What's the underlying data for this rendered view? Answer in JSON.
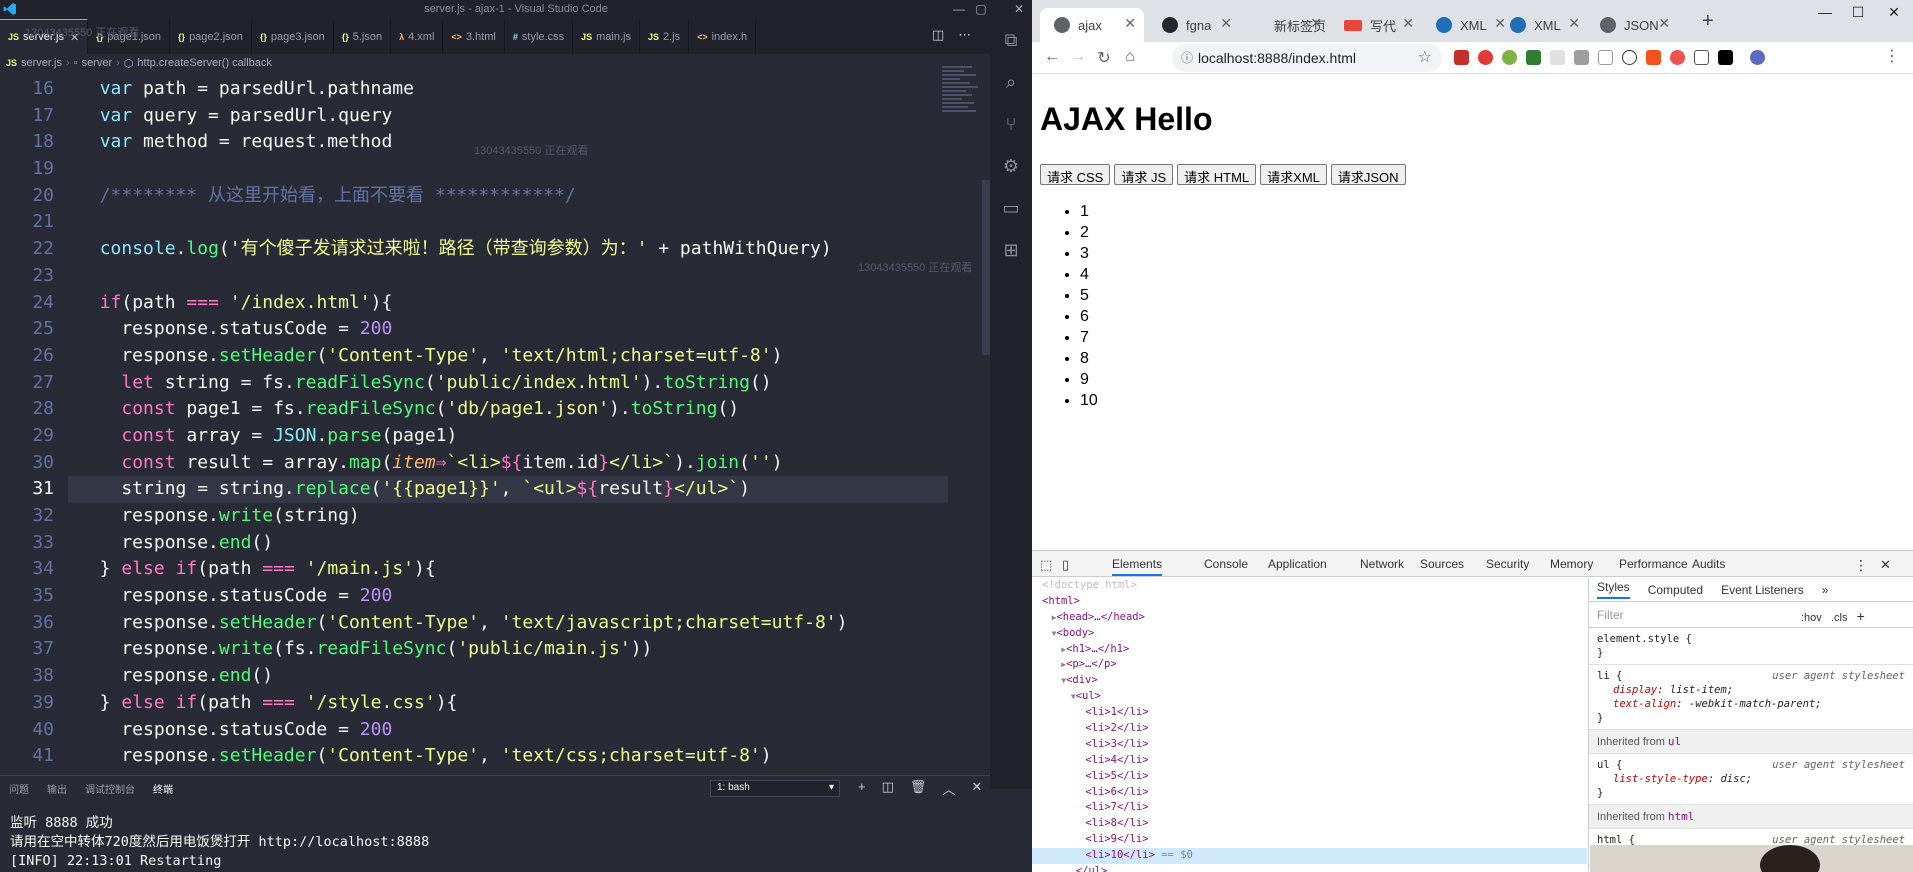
{
  "vscode": {
    "window_title": "server.js - ajax-1 - Visual Studio Code",
    "tabs": [
      {
        "label": "server.js",
        "icon": "JS",
        "icon_color": "#f1fa8c",
        "active": true
      },
      {
        "label": "page1.json",
        "icon": "{}",
        "icon_color": "#f1fa8c"
      },
      {
        "label": "page2.json",
        "icon": "{}",
        "icon_color": "#f1fa8c"
      },
      {
        "label": "page3.json",
        "icon": "{}",
        "icon_color": "#f1fa8c"
      },
      {
        "label": "5.json",
        "icon": "{}",
        "icon_color": "#f1fa8c"
      },
      {
        "label": "4.xml",
        "icon": "λ",
        "icon_color": "#ffb86c"
      },
      {
        "label": "3.html",
        "icon": "<>",
        "icon_color": "#ffb86c"
      },
      {
        "label": "style.css",
        "icon": "#",
        "icon_color": "#8be9fd"
      },
      {
        "label": "main.js",
        "icon": "JS",
        "icon_color": "#f1fa8c"
      },
      {
        "label": "2.js",
        "icon": "JS",
        "icon_color": "#f1fa8c"
      },
      {
        "label": "index.h",
        "icon": "<>",
        "icon_color": "#ffb86c"
      }
    ],
    "breadcrumb": [
      "server.js",
      "server",
      "http.createServer() callback"
    ],
    "watermark_text": "13043435550 正在观看",
    "line_numbers": [
      "16",
      "17",
      "18",
      "19",
      "20",
      "21",
      "22",
      "23",
      "24",
      "25",
      "26",
      "27",
      "28",
      "29",
      "30",
      "31",
      "32",
      "33",
      "34",
      "35",
      "36",
      "37",
      "38",
      "39",
      "40",
      "41"
    ],
    "current_line": "31",
    "code_lines": [
      [
        [
          "  ",
          "pl"
        ],
        [
          "var",
          "cls"
        ],
        [
          " path = parsedUrl.",
          "pl"
        ],
        [
          "pathname",
          "pl"
        ]
      ],
      [
        [
          "  ",
          "pl"
        ],
        [
          "var",
          "cls"
        ],
        [
          " query = parsedUrl.",
          "pl"
        ],
        [
          "query",
          "pl"
        ]
      ],
      [
        [
          "  ",
          "pl"
        ],
        [
          "var",
          "cls"
        ],
        [
          " method = ",
          "pl"
        ],
        [
          "request",
          "pl"
        ],
        [
          ".method",
          "pl"
        ]
      ],
      [
        [
          "",
          "pl"
        ]
      ],
      [
        [
          "  /******** 从这里开始看，上面不要看 ************/",
          "cm"
        ]
      ],
      [
        [
          "",
          "pl"
        ]
      ],
      [
        [
          "  ",
          "pl"
        ],
        [
          "console",
          "cls"
        ],
        [
          ".",
          "pl"
        ],
        [
          "log",
          "fn"
        ],
        [
          "(",
          "pl"
        ],
        [
          "'有个傻子发请求过来啦！路径（带查询参数）为：'",
          "str"
        ],
        [
          " + pathWithQuery)",
          "pl"
        ]
      ],
      [
        [
          "",
          "pl"
        ]
      ],
      [
        [
          "  ",
          "pl"
        ],
        [
          "if",
          "kw"
        ],
        [
          "(path ",
          "pl"
        ],
        [
          "===",
          "kw"
        ],
        [
          " ",
          "pl"
        ],
        [
          "'/index.html'",
          "str"
        ],
        [
          "){",
          "pl"
        ]
      ],
      [
        [
          "    response.",
          "pl"
        ],
        [
          "statusCode",
          "pl"
        ],
        [
          " = ",
          "pl"
        ],
        [
          "200",
          "num"
        ]
      ],
      [
        [
          "    response.",
          "pl"
        ],
        [
          "setHeader",
          "fn"
        ],
        [
          "(",
          "pl"
        ],
        [
          "'Content-Type'",
          "str"
        ],
        [
          ", ",
          "pl"
        ],
        [
          "'text/html;charset=utf-8'",
          "str"
        ],
        [
          ")",
          "pl"
        ]
      ],
      [
        [
          "    ",
          "pl"
        ],
        [
          "let",
          "kw"
        ],
        [
          " string = ",
          "pl"
        ],
        [
          "fs",
          "pl"
        ],
        [
          ".",
          "pl"
        ],
        [
          "readFileSync",
          "fn"
        ],
        [
          "(",
          "pl"
        ],
        [
          "'public/index.html'",
          "str"
        ],
        [
          ").",
          "pl"
        ],
        [
          "toString",
          "fn"
        ],
        [
          "()",
          "pl"
        ]
      ],
      [
        [
          "    ",
          "pl"
        ],
        [
          "const",
          "kw"
        ],
        [
          " page1 = fs.",
          "pl"
        ],
        [
          "readFileSync",
          "fn"
        ],
        [
          "(",
          "pl"
        ],
        [
          "'db/page1.json'",
          "str"
        ],
        [
          ").",
          "pl"
        ],
        [
          "toString",
          "fn"
        ],
        [
          "()",
          "pl"
        ]
      ],
      [
        [
          "    ",
          "pl"
        ],
        [
          "const",
          "kw"
        ],
        [
          " array = ",
          "pl"
        ],
        [
          "JSON",
          "cls"
        ],
        [
          ".",
          "pl"
        ],
        [
          "parse",
          "fn"
        ],
        [
          "(page1)",
          "pl"
        ]
      ],
      [
        [
          "    ",
          "pl"
        ],
        [
          "const",
          "kw"
        ],
        [
          " result = array.",
          "pl"
        ],
        [
          "map",
          "fn"
        ],
        [
          "(",
          "pl"
        ],
        [
          "item",
          "ita"
        ],
        [
          "⇒",
          "kw"
        ],
        [
          "`<li>",
          "str"
        ],
        [
          "${",
          "kw"
        ],
        [
          "item.id",
          "pl"
        ],
        [
          "}",
          "kw"
        ],
        [
          "</li>`",
          "str"
        ],
        [
          ").",
          "pl"
        ],
        [
          "join",
          "fn"
        ],
        [
          "(",
          "pl"
        ],
        [
          "''",
          "str"
        ],
        [
          ")",
          "pl"
        ]
      ],
      [
        [
          "    string = string.",
          "pl"
        ],
        [
          "replace",
          "fn"
        ],
        [
          "(",
          "pl"
        ],
        [
          "'{{page1}}'",
          "str"
        ],
        [
          ", ",
          "pl"
        ],
        [
          "`<ul>",
          "str"
        ],
        [
          "${",
          "kw"
        ],
        [
          "result",
          "pl"
        ],
        [
          "}",
          "kw"
        ],
        [
          "</ul>`",
          "str"
        ],
        [
          ")",
          "pl"
        ]
      ],
      [
        [
          "    response.",
          "pl"
        ],
        [
          "write",
          "fn"
        ],
        [
          "(string)",
          "pl"
        ]
      ],
      [
        [
          "    response.",
          "pl"
        ],
        [
          "end",
          "fn"
        ],
        [
          "()",
          "pl"
        ]
      ],
      [
        [
          "  } ",
          "pl"
        ],
        [
          "else",
          "kw"
        ],
        [
          " ",
          "pl"
        ],
        [
          "if",
          "kw"
        ],
        [
          "(path ",
          "pl"
        ],
        [
          "===",
          "kw"
        ],
        [
          " ",
          "pl"
        ],
        [
          "'/main.js'",
          "str"
        ],
        [
          "){",
          "pl"
        ]
      ],
      [
        [
          "    response.",
          "pl"
        ],
        [
          "statusCode",
          "pl"
        ],
        [
          " = ",
          "pl"
        ],
        [
          "200",
          "num"
        ]
      ],
      [
        [
          "    response.",
          "pl"
        ],
        [
          "setHeader",
          "fn"
        ],
        [
          "(",
          "pl"
        ],
        [
          "'Content-Type'",
          "str"
        ],
        [
          ", ",
          "pl"
        ],
        [
          "'text/javascript;charset=utf-8'",
          "str"
        ],
        [
          ")",
          "pl"
        ]
      ],
      [
        [
          "    response.",
          "pl"
        ],
        [
          "write",
          "fn"
        ],
        [
          "(fs.",
          "pl"
        ],
        [
          "readFileSync",
          "fn"
        ],
        [
          "(",
          "pl"
        ],
        [
          "'public/main.js'",
          "str"
        ],
        [
          "))",
          "pl"
        ]
      ],
      [
        [
          "    response.",
          "pl"
        ],
        [
          "end",
          "fn"
        ],
        [
          "()",
          "pl"
        ]
      ],
      [
        [
          "  } ",
          "pl"
        ],
        [
          "else",
          "kw"
        ],
        [
          " ",
          "pl"
        ],
        [
          "if",
          "kw"
        ],
        [
          "(path ",
          "pl"
        ],
        [
          "===",
          "kw"
        ],
        [
          " ",
          "pl"
        ],
        [
          "'/style.css'",
          "str"
        ],
        [
          "){",
          "pl"
        ]
      ],
      [
        [
          "    response.",
          "pl"
        ],
        [
          "statusCode",
          "pl"
        ],
        [
          " = ",
          "pl"
        ],
        [
          "200",
          "num"
        ]
      ],
      [
        [
          "    response.",
          "pl"
        ],
        [
          "setHeader",
          "fn"
        ],
        [
          "(",
          "pl"
        ],
        [
          "'Content-Type'",
          "str"
        ],
        [
          ", ",
          "pl"
        ],
        [
          "'text/css;charset=utf-8'",
          "str"
        ],
        [
          ")",
          "pl"
        ]
      ]
    ],
    "panel_tabs": [
      "问题",
      "输出",
      "调试控制台",
      "终端"
    ],
    "active_panel_tab": "终端",
    "terminal_select": "1: bash",
    "terminal_lines": [
      "监听 8888 成功",
      "请用在空中转体720度然后用电饭煲打开 http://localhost:8888",
      "[INFO] 22:13:01 Restarting"
    ]
  },
  "chrome": {
    "tabs": [
      {
        "label": "ajax",
        "active": true,
        "fav_color": "#5f6368"
      },
      {
        "label": "fgnа",
        "fav_color": "#24292e"
      },
      {
        "label": "新标签页",
        "fav_color": "#dee1e6"
      },
      {
        "label": "写代",
        "fav_color": "#e8453c",
        "prefix": "XML"
      },
      {
        "label": "XML",
        "fav_color": "#1f6fb6"
      },
      {
        "label": "XML",
        "fav_color": "#1f6fb6"
      },
      {
        "label": "JSON",
        "fav_color": "#5f6368"
      }
    ],
    "url": "localhost:8888/index.html",
    "page": {
      "heading": "AJAX Hello",
      "buttons": [
        "请求 CSS",
        "请求 JS",
        "请求 HTML",
        "请求XML",
        "请求JSON"
      ],
      "list": [
        "1",
        "2",
        "3",
        "4",
        "5",
        "6",
        "7",
        "8",
        "9",
        "10"
      ]
    },
    "devtools": {
      "tabs": [
        "Elements",
        "Console",
        "Application",
        "Network",
        "Sources",
        "Security",
        "Memory",
        "Performance",
        "Audits"
      ],
      "active_tab": "Elements",
      "styles_tabs": [
        "Styles",
        "Computed",
        "Event Listeners"
      ],
      "filter_placeholder": "Filter",
      "hov_label": ":hov",
      "cls_label": ".cls",
      "selected_suffix": "== $0",
      "dom_tree": [
        {
          "indent": 0,
          "text": "<!doctype html>",
          "kind": "doctype"
        },
        {
          "indent": 0,
          "text": "<html>",
          "kind": "tag"
        },
        {
          "indent": 1,
          "text": "<head>…</head>",
          "kind": "tag",
          "arrow": "▶"
        },
        {
          "indent": 1,
          "text": "<body>",
          "kind": "tag",
          "arrow": "▼"
        },
        {
          "indent": 2,
          "text": "<h1>…</h1>",
          "kind": "tag",
          "arrow": "▶"
        },
        {
          "indent": 2,
          "text": "<p>…</p>",
          "kind": "tag",
          "arrow": "▶"
        },
        {
          "indent": 2,
          "text": "<div>",
          "kind": "tag",
          "arrow": "▼"
        },
        {
          "indent": 3,
          "text": "<ul>",
          "kind": "tag",
          "arrow": "▼"
        },
        {
          "indent": 4,
          "text": "<li>1</li>",
          "kind": "tag"
        },
        {
          "indent": 4,
          "text": "<li>2</li>",
          "kind": "tag"
        },
        {
          "indent": 4,
          "text": "<li>3</li>",
          "kind": "tag"
        },
        {
          "indent": 4,
          "text": "<li>4</li>",
          "kind": "tag"
        },
        {
          "indent": 4,
          "text": "<li>5</li>",
          "kind": "tag"
        },
        {
          "indent": 4,
          "text": "<li>6</li>",
          "kind": "tag"
        },
        {
          "indent": 4,
          "text": "<li>7</li>",
          "kind": "tag"
        },
        {
          "indent": 4,
          "text": "<li>8</li>",
          "kind": "tag"
        },
        {
          "indent": 4,
          "text": "<li>9</li>",
          "kind": "tag"
        },
        {
          "indent": 4,
          "text": "<li>10</li>",
          "kind": "tag",
          "selected": true
        },
        {
          "indent": 3,
          "text": "</ul>",
          "kind": "tag"
        }
      ],
      "rules": [
        {
          "selector": "element.style {",
          "source": "",
          "props": []
        },
        {
          "selector": "li {",
          "source": "user agent stylesheet",
          "props": [
            [
              "display",
              "list-item;"
            ],
            [
              "text-align",
              "-webkit-match-parent;"
            ]
          ]
        },
        {
          "inherited": "ul"
        },
        {
          "selector": "ul {",
          "source": "user agent stylesheet",
          "props": [
            [
              "list-style-type",
              "disc;"
            ]
          ]
        },
        {
          "inherited": "html"
        },
        {
          "selector": "html {",
          "source": "user agent stylesheet",
          "props": []
        }
      ],
      "inherited_from_label": "Inherited from"
    }
  }
}
